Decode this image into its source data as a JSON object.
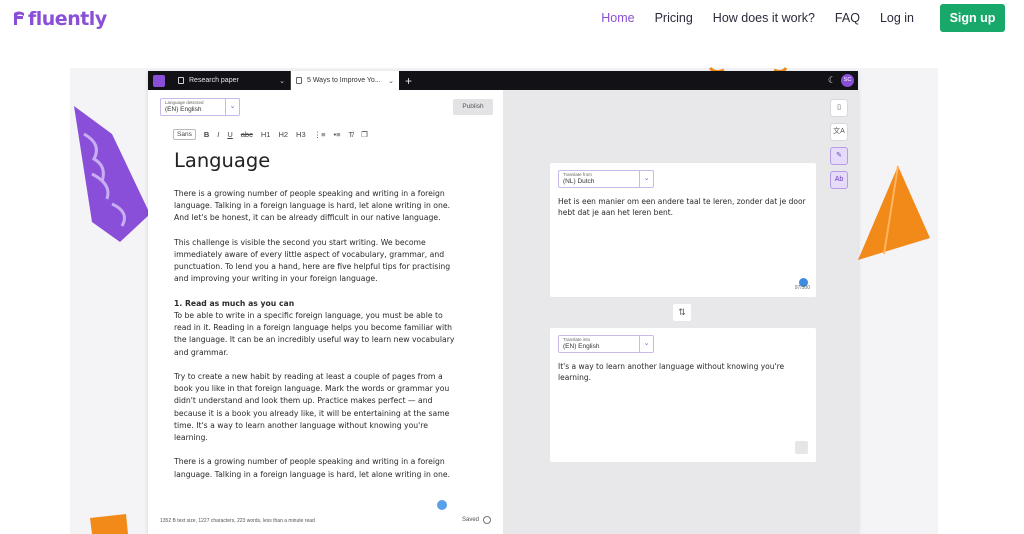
{
  "nav": {
    "logo": "fluently",
    "links": [
      "Home",
      "Pricing",
      "How does it work?",
      "FAQ",
      "Log in"
    ],
    "signup": "Sign up"
  },
  "app": {
    "tabs": [
      {
        "label": "Research paper",
        "chevron": "⌄"
      },
      {
        "label": "5 Ways to Improve Yo...",
        "chevron": "⌄"
      }
    ],
    "add_tab": "+",
    "theme_icon": "☾",
    "avatar_initials": "SC",
    "editor": {
      "language_label": "Language detected",
      "language_value": "(EN) English",
      "publish": "Publish",
      "toolbar": [
        "Sans",
        "B",
        "I",
        "U",
        "abc",
        "H1",
        "H2",
        "H3"
      ],
      "heading": "Language",
      "paragraphs": [
        "There is a growing number of people speaking and writing in a foreign language. Talking in a foreign language is hard, let alone writing in one. And let's be honest, it can be already difficult in our native language.",
        "This challenge is visible the second you start writing. We become immediately aware of every little aspect of vocabulary, grammar, and punctuation. To lend you a hand, here are five helpful tips for practising and improving your writing in your foreign language."
      ],
      "section_title": "1. Read as much as you can",
      "section_paragraphs": [
        "To be able to write in a specific foreign language, you must be able to read in it. Reading in a foreign language helps you become familiar with the language. It can be an incredibly useful way to learn new vocabulary and grammar.",
        "Try to create a new habit by reading at least a couple of pages from a book you like in that foreign language. Mark the words or grammar you didn't understand and look them up. Practice makes perfect — and because it is a book you already like, it will be entertaining at the same time. It's a way to learn another language without knowing you're learning.",
        "There is a growing number of people speaking and writing in a foreign language. Talking in a foreign language is hard, let alone writing in one."
      ],
      "status": "1352 B text size, 1227 characters, 223 words, less than a minute read",
      "saved": "Saved"
    },
    "translate": {
      "from_label": "Translate from",
      "from_value": "(NL) Dutch",
      "from_text": "Het is een manier om een andere taal te leren, zonder dat je door hebt dat je aan het leren bent.",
      "score": "97/100",
      "to_label": "Translate into",
      "to_value": "(EN) English",
      "to_text": "It's a way to learn another language without knowing you're learning.",
      "swap_icon": "⇅",
      "side_icons": [
        "document-icon",
        "translate-icon",
        "rephrase-icon",
        "spellcheck-icon"
      ],
      "side_labels": [
        "▯",
        "文A",
        "✎",
        "Ab"
      ]
    }
  },
  "colors": {
    "brand": "#8a4fd8",
    "signup": "#17a86a",
    "deco_orange": "#f28a1a",
    "deco_purple": "#8a4fd8"
  }
}
